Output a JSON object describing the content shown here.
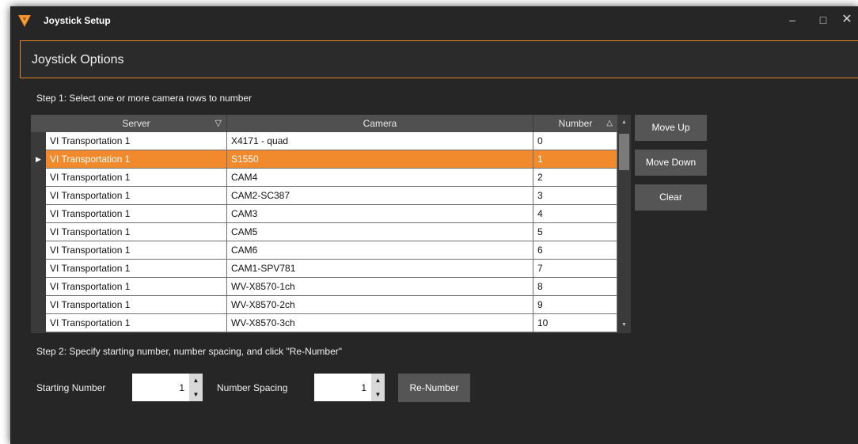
{
  "window": {
    "title": "Joystick Setup",
    "minimize_glyph": "–",
    "maximize_glyph": "□",
    "close_glyph": "✕"
  },
  "panel": {
    "header": "Joystick Options"
  },
  "step1": "Step 1:  Select one or more camera rows to number",
  "step2": "Step 2:  Specify starting number, number spacing, and click \"Re-Number\"",
  "grid": {
    "columns": {
      "server": "Server",
      "camera": "Camera",
      "number": "Number"
    },
    "filter_glyph": "▽",
    "sort_glyph": "△",
    "selected_row_index": 1,
    "rows": [
      {
        "server": "VI Transportation 1",
        "camera": "X4171 - quad",
        "number": "0"
      },
      {
        "server": "VI Transportation 1",
        "camera": "S1550",
        "number": "1"
      },
      {
        "server": "VI Transportation 1",
        "camera": "CAM4",
        "number": "2"
      },
      {
        "server": "VI Transportation 1",
        "camera": "CAM2-SC387",
        "number": "3"
      },
      {
        "server": "VI Transportation 1",
        "camera": "CAM3",
        "number": "4"
      },
      {
        "server": "VI Transportation 1",
        "camera": "CAM5",
        "number": "5"
      },
      {
        "server": "VI Transportation 1",
        "camera": "CAM6",
        "number": "6"
      },
      {
        "server": "VI Transportation 1",
        "camera": "CAM1-SPV781",
        "number": "7"
      },
      {
        "server": "VI Transportation 1",
        "camera": "WV-X8570-1ch",
        "number": "8"
      },
      {
        "server": "VI Transportation 1",
        "camera": "WV-X8570-2ch",
        "number": "9"
      },
      {
        "server": "VI Transportation 1",
        "camera": "WV-X8570-3ch",
        "number": "10"
      }
    ]
  },
  "buttons": {
    "move_up": "Move Up",
    "move_down": "Move Down",
    "clear": "Clear",
    "renumber": "Re-Number"
  },
  "starting_number": {
    "label": "Starting Number",
    "value": "1"
  },
  "number_spacing": {
    "label": "Number Spacing",
    "value": "1"
  },
  "colors": {
    "accent": "#f08a2c",
    "background": "#262626",
    "button": "#555555"
  }
}
